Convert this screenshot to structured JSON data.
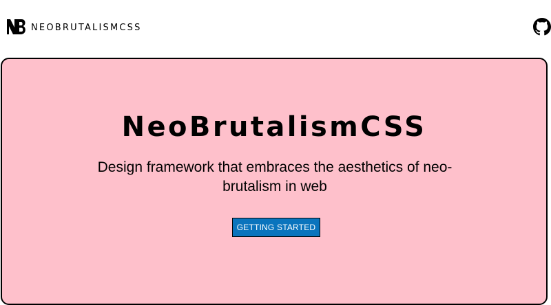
{
  "header": {
    "brand_name": "NEOBRUTALISMCSS",
    "logo_icon": "nb-logo-icon",
    "repo_icon": "github-icon"
  },
  "hero": {
    "title": "NeoBrutalismCSS",
    "subtitle": "Design framework that embraces the aesthetics of neo-brutalism in web",
    "cta_label": "GETTING STARTED"
  },
  "colors": {
    "hero_background": "#fec0cb",
    "cta_background": "#0a74bd",
    "border": "#000000"
  }
}
